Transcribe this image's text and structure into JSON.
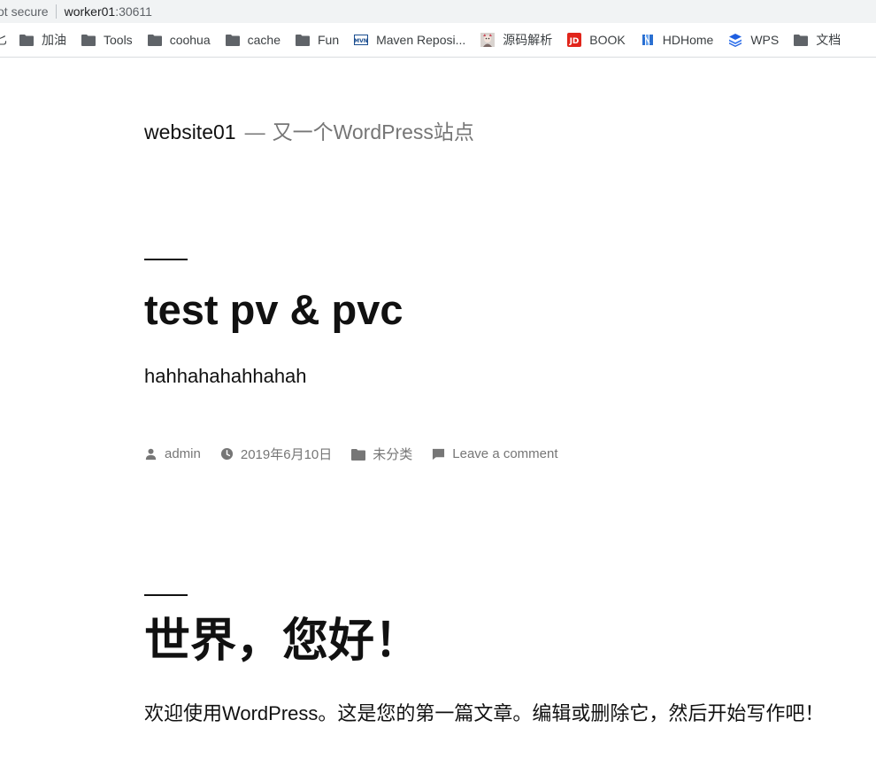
{
  "browser": {
    "security_label": "ot secure",
    "host": "worker01",
    "port": ":30611"
  },
  "bookmarks": [
    {
      "label": "加油",
      "icon": "folder-icon"
    },
    {
      "label": "Tools",
      "icon": "folder-icon"
    },
    {
      "label": "coohua",
      "icon": "folder-icon"
    },
    {
      "label": "cache",
      "icon": "folder-icon"
    },
    {
      "label": "Fun",
      "icon": "folder-icon"
    },
    {
      "label": "Maven Reposi...",
      "icon": "maven-icon"
    },
    {
      "label": "源码解析",
      "icon": "avatar-icon"
    },
    {
      "label": "BOOK",
      "icon": "jd-icon"
    },
    {
      "label": "HDHome",
      "icon": "hdhome-icon"
    },
    {
      "label": "WPS",
      "icon": "wps-icon"
    },
    {
      "label": "文档",
      "icon": "folder-icon"
    }
  ],
  "bookmark_partial": "匕",
  "site": {
    "title": "website01",
    "separator": "—",
    "description": "又一个WordPress站点"
  },
  "posts": [
    {
      "title": "test pv & pvc",
      "body": "hahhahahahhahah",
      "meta": {
        "author": "admin",
        "date": "2019年6月10日",
        "category": "未分类",
        "comments": "Leave a comment"
      }
    },
    {
      "title": "世界，您好！",
      "body": "欢迎使用WordPress。这是您的第一篇文章。编辑或删除它，然后开始写作吧！"
    }
  ],
  "colors": {
    "text": "#111111",
    "muted": "#767676",
    "chrome_bg": "#f1f3f4",
    "folder_icon": "#5f6368"
  }
}
